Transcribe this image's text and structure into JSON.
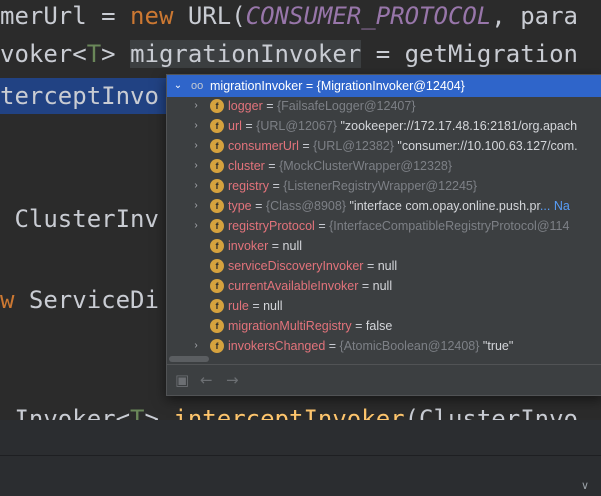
{
  "editor": {
    "line1": {
      "a": "merUrl = ",
      "kw": "new",
      "b": " URL(",
      "const": "CONSUMER_PROTOCOL",
      "c": ", para"
    },
    "line2": {
      "a": "voker<",
      "type": "T",
      "b": "> ",
      "word": "migrationInvoker",
      "c": " = getMigration"
    },
    "line3": {
      "a": "terceptInvo"
    },
    "line4": {
      "a": " ClusterInv"
    },
    "line5": {
      "kw": "w",
      "a": " ServiceDi"
    },
    "line6": {
      "a": " Invoker<",
      "type": "T",
      "b": "> ",
      "fn": "interceptInvoker",
      "c": "(ClusterInvo"
    }
  },
  "popup": {
    "root": {
      "name": "migrationInvoker",
      "eq": " = ",
      "ref": "{MigrationInvoker@12404}"
    },
    "fields": [
      {
        "name": "logger",
        "ref": "{FailsafeLogger@12407}",
        "val": "",
        "link": "",
        "expandable": true
      },
      {
        "name": "url",
        "ref": "{URL@12067}",
        "val": "\"zookeeper://172.17.48.16:2181/org.apach",
        "link": "",
        "expandable": true
      },
      {
        "name": "consumerUrl",
        "ref": "{URL@12382}",
        "val": "\"consumer://10.100.63.127/com.",
        "link": "",
        "expandable": true
      },
      {
        "name": "cluster",
        "ref": "{MockClusterWrapper@12328}",
        "val": "",
        "link": "",
        "expandable": true
      },
      {
        "name": "registry",
        "ref": "{ListenerRegistryWrapper@12245}",
        "val": "",
        "link": "",
        "expandable": true
      },
      {
        "name": "type",
        "ref": "{Class@8908}",
        "val": "\"interface com.opay.online.push.pr",
        "link": "... Na",
        "expandable": true
      },
      {
        "name": "registryProtocol",
        "ref": "{InterfaceCompatibleRegistryProtocol@114",
        "val": "",
        "link": "",
        "expandable": true
      },
      {
        "name": "invoker",
        "ref": "",
        "val": "null",
        "link": "",
        "expandable": false
      },
      {
        "name": "serviceDiscoveryInvoker",
        "ref": "",
        "val": "null",
        "link": "",
        "expandable": false
      },
      {
        "name": "currentAvailableInvoker",
        "ref": "",
        "val": "null",
        "link": "",
        "expandable": false
      },
      {
        "name": "rule",
        "ref": "",
        "val": "null",
        "link": "",
        "expandable": false
      },
      {
        "name": "migrationMultiRegistry",
        "ref": "",
        "val": "false",
        "link": "",
        "expandable": false
      },
      {
        "name": "invokersChanged",
        "ref": "{AtomicBoolean@12408}",
        "val": "\"true\"",
        "link": "",
        "expandable": true
      }
    ],
    "icons": {
      "field": "f",
      "toggle_expanded": "⌄",
      "toggle_collapsed": "›",
      "object": "oo"
    }
  },
  "toolbar": {
    "icons": [
      "pin-icon",
      "back-arrow-icon",
      "forward-arrow-icon"
    ],
    "back": "←",
    "forward": "→",
    "pin": "▣"
  },
  "bottom": {
    "chevron": "∨"
  },
  "colors": {
    "selection": "#2f65ca",
    "field_name": "#e2737b",
    "field_icon": "#d6a23e",
    "link": "#589df6"
  }
}
